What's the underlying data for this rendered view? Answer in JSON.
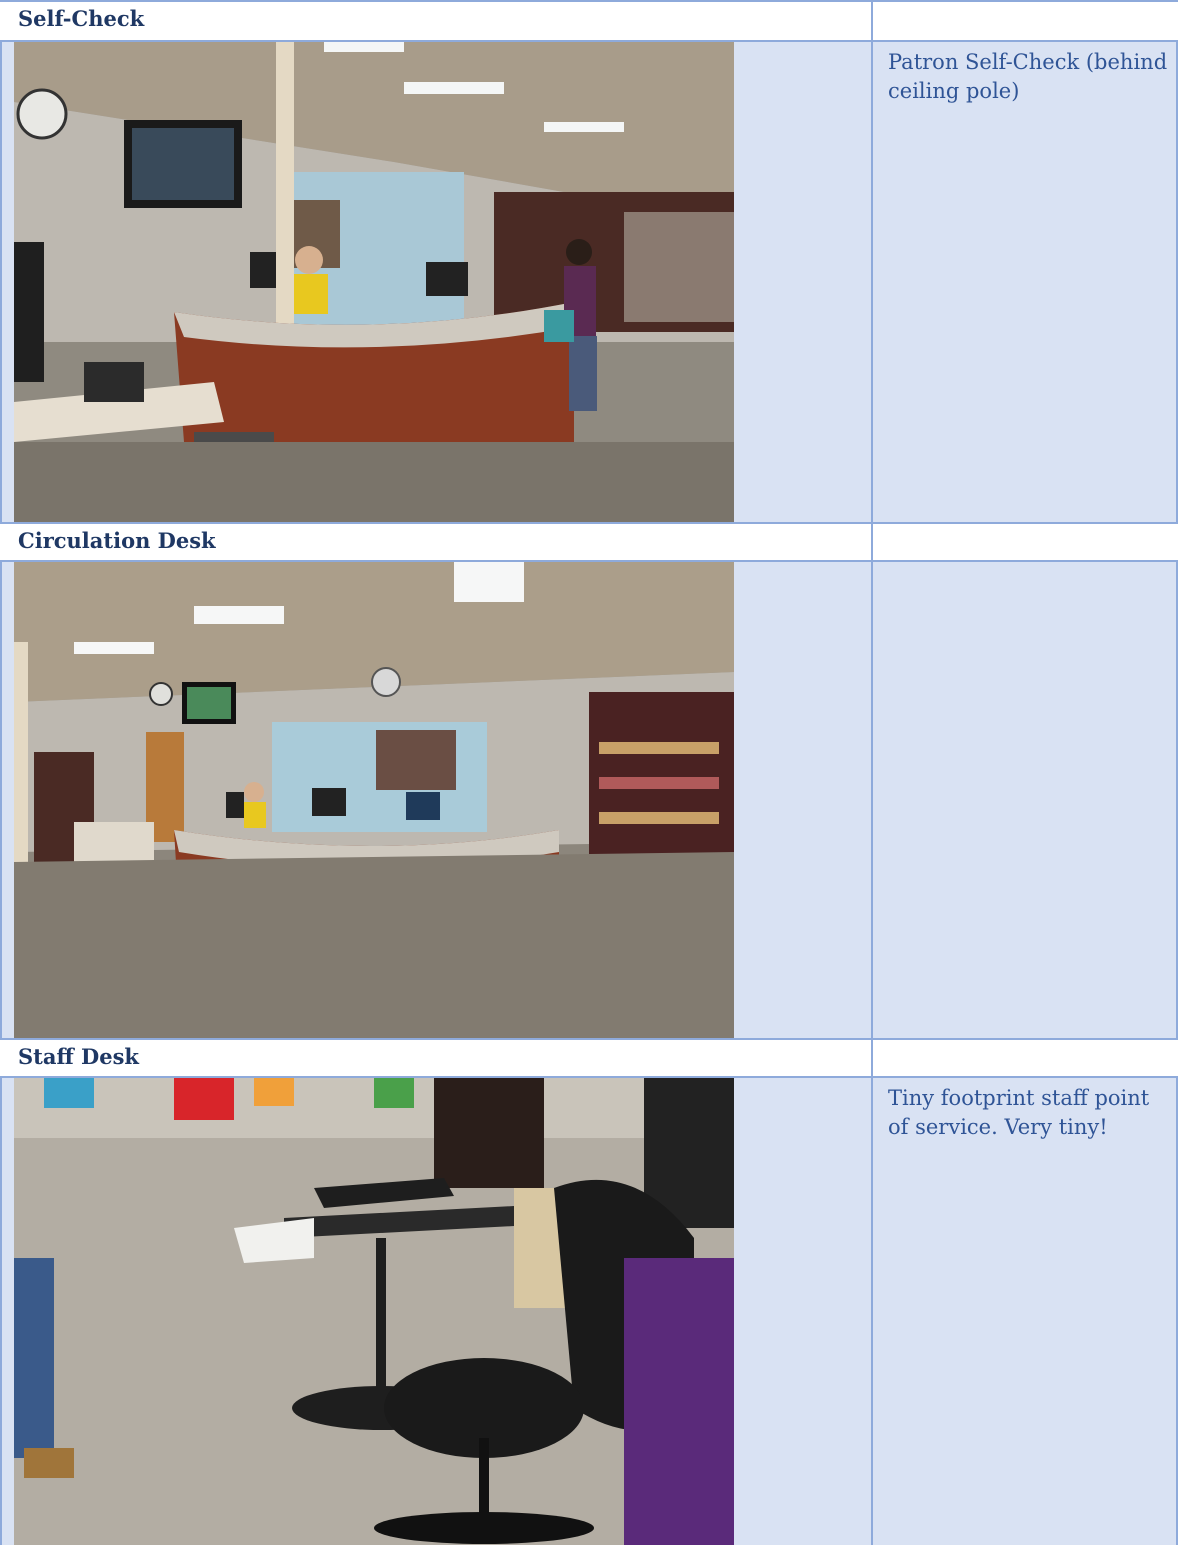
{
  "sections": [
    {
      "title": "Self-Check",
      "note": "Patron Self-Check (behind ceiling pole)",
      "photo": "library-self-check-area-photo"
    },
    {
      "title": "Circulation Desk",
      "note": "",
      "photo": "library-circulation-desk-photo"
    },
    {
      "title": "Staff Desk",
      "note": "Tiny footprint staff point of service.  Very tiny!",
      "photo": "staff-laptop-cart-and-chair-photo"
    }
  ],
  "colors": {
    "header_text": "#1f3864",
    "note_text": "#2f5496",
    "cell_fill": "#d9e2f3",
    "border": "#8eaadb"
  }
}
